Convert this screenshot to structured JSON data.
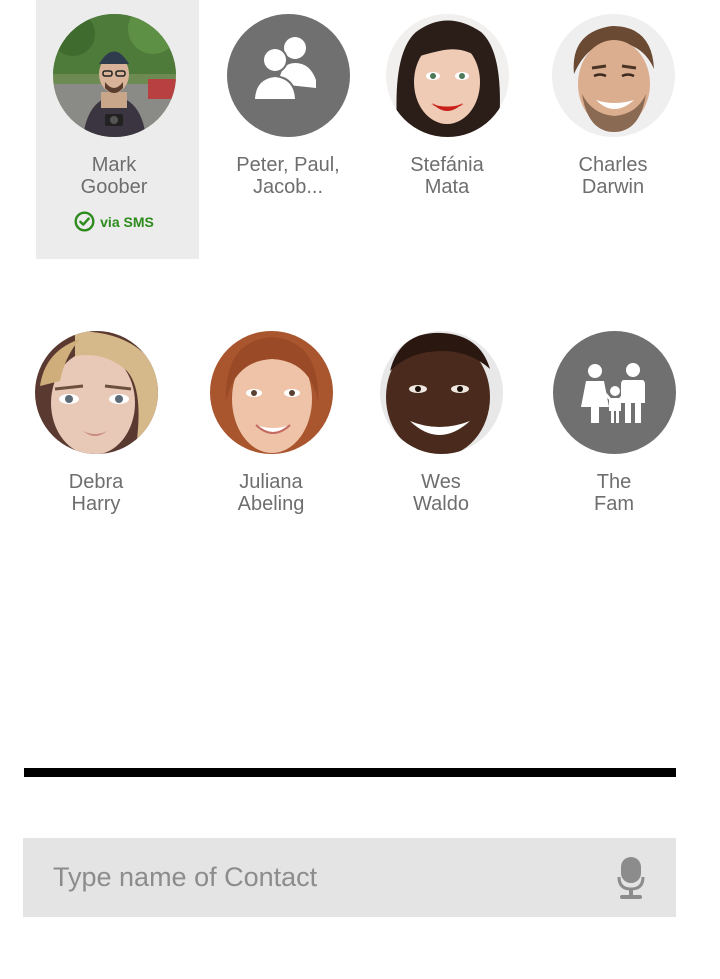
{
  "contacts": [
    {
      "first": "Mark",
      "last": "Goober",
      "avatar": "photo-man-beanie-camera-icon",
      "selected": true,
      "badge": "via SMS"
    },
    {
      "first": "Peter, Paul,",
      "last": "Jacob...",
      "avatar": "group-icon",
      "selected": false
    },
    {
      "first": "Stefánia",
      "last": "Mata",
      "avatar": "photo-woman-dark-hair-icon",
      "selected": false
    },
    {
      "first": "Charles",
      "last": "Darwin",
      "avatar": "photo-man-smiling-icon",
      "selected": false
    },
    {
      "first": "Debra",
      "last": "Harry",
      "avatar": "photo-woman-blonde-icon",
      "selected": false
    },
    {
      "first": "Juliana",
      "last": "Abeling",
      "avatar": "photo-woman-redhead-icon",
      "selected": false
    },
    {
      "first": "Wes",
      "last": "Waldo",
      "avatar": "photo-man-dark-skin-icon",
      "selected": false
    },
    {
      "first": "The",
      "last": "Fam",
      "avatar": "family-icon",
      "selected": false
    }
  ],
  "search": {
    "placeholder": "Type name of Contact",
    "mic_icon": "microphone-icon"
  },
  "colors": {
    "icon_bg": "#707070",
    "name_text": "#6e6e6e",
    "sms_green": "#2e8b1e",
    "selected_bg": "#ececec",
    "search_bg": "#e4e4e4"
  }
}
